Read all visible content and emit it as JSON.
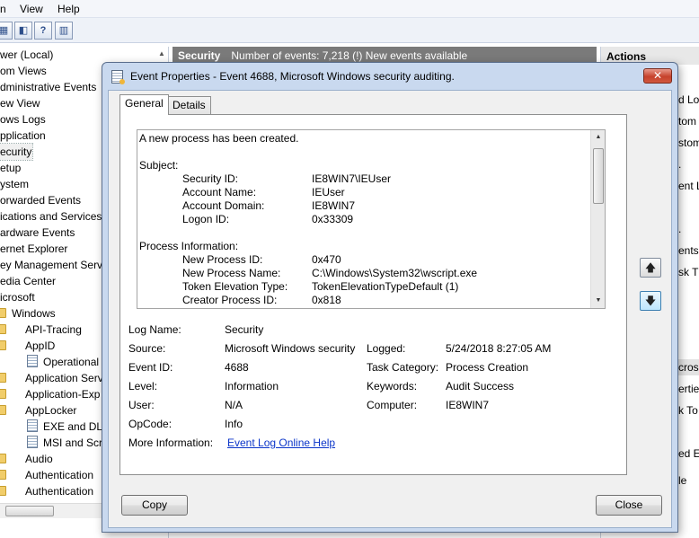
{
  "menubar": {
    "items": [
      "n",
      "View",
      "Help"
    ]
  },
  "toolbar": {
    "icons": [
      "console-tree-icon",
      "properties-icon",
      "help-icon",
      "action-pane-icon"
    ]
  },
  "tree": {
    "scroll_up_glyph": "▲",
    "items": [
      "wer (Local)",
      "om Views",
      "dministrative Events",
      "ew View",
      "ows Logs",
      "pplication",
      "ecurity",
      "etup",
      "ystem",
      "orwarded Events",
      "ications and Services L",
      "ardware Events",
      "ernet Explorer",
      "ey Management Servi",
      "edia Center",
      "icrosoft",
      "Windows",
      "API-Tracing",
      "AppID",
      "Operational",
      "Application Serv",
      "Application-Exp",
      "AppLocker",
      "EXE and DLL",
      "MSI and Scri",
      "Audio",
      "Authentication",
      "Authentication"
    ]
  },
  "center": {
    "header_title": "Security",
    "header_info": "Number of events: 7,218 (!) New events available"
  },
  "actions": {
    "title": "Actions",
    "items": [
      "d Lo",
      "tom",
      "stom",
      ".",
      "ent L",
      ".",
      "ents",
      "sk T",
      "",
      "",
      "",
      "croso",
      "ertie",
      "k To",
      "",
      "ed E",
      "le"
    ]
  },
  "dialog": {
    "title": "Event Properties - Event 4688, Microsoft Windows security auditing.",
    "close_glyph": "✕",
    "tabs": {
      "general": "General",
      "details": "Details"
    },
    "message": {
      "intro": "A new process has been created.",
      "subject_header": "Subject:",
      "subject": [
        {
          "label": "Security ID:",
          "value": "IE8WIN7\\IEUser"
        },
        {
          "label": "Account Name:",
          "value": "IEUser"
        },
        {
          "label": "Account Domain:",
          "value": "IE8WIN7"
        },
        {
          "label": "Logon ID:",
          "value": "0x33309"
        }
      ],
      "process_header": "Process Information:",
      "process": [
        {
          "label": "New Process ID:",
          "value": "0x470"
        },
        {
          "label": "New Process Name:",
          "value": "C:\\Windows\\System32\\wscript.exe"
        },
        {
          "label": "Token Elevation Type:",
          "value": "TokenElevationTypeDefault (1)"
        },
        {
          "label": "Creator Process ID:",
          "value": "0x818"
        }
      ],
      "scroll_up": "▲",
      "scroll_down": "▼"
    },
    "fields": {
      "log_name": {
        "label": "Log Name:",
        "value": "Security"
      },
      "source": {
        "label": "Source:",
        "value": "Microsoft Windows security"
      },
      "logged": {
        "label": "Logged:",
        "value": "5/24/2018 8:27:05 AM"
      },
      "event_id": {
        "label": "Event ID:",
        "value": "4688"
      },
      "task_category": {
        "label": "Task Category:",
        "value": "Process Creation"
      },
      "level": {
        "label": "Level:",
        "value": "Information"
      },
      "keywords": {
        "label": "Keywords:",
        "value": "Audit Success"
      },
      "user": {
        "label": "User:",
        "value": "N/A"
      },
      "computer": {
        "label": "Computer:",
        "value": "IE8WIN7"
      },
      "opcode": {
        "label": "OpCode:",
        "value": "Info"
      },
      "more_info": {
        "label": "More Information:",
        "value": "Event Log Online Help"
      }
    },
    "nav": {
      "up_glyph": "🡅",
      "down_glyph": "🡇"
    },
    "buttons": {
      "copy": "Copy",
      "close": "Close"
    }
  }
}
